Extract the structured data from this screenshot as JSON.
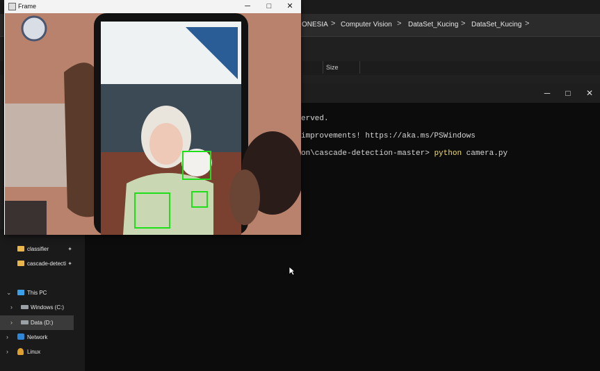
{
  "explorer": {
    "breadcrumbs": [
      "ONESIA",
      "Computer Vision",
      "DataSet_Kucing",
      "DataSet_Kucing"
    ],
    "breadcrumb_separator": ">",
    "column_headers": {
      "size": "Size"
    },
    "sidebar": {
      "items": [
        {
          "label": "classifier",
          "pinned": true
        },
        {
          "label": "cascade-detecti",
          "pinned": true
        }
      ],
      "this_pc": "This PC",
      "drives": [
        "Windows (C:)",
        "Data (D:)"
      ],
      "network": "Network",
      "linux": "Linux"
    }
  },
  "terminal": {
    "lines": [
      {
        "text": "erved."
      },
      {
        "text": "improvements! https://aka.ms/PSWindows"
      },
      {
        "prompt": "on\\cascade-detection-master> ",
        "command": "python",
        "args": " camera.py"
      }
    ],
    "buttons": {
      "minimize": "─",
      "maximize": "□",
      "close": "✕"
    }
  },
  "frame": {
    "title": "Frame",
    "buttons": {
      "minimize": "─",
      "maximize": "□",
      "close": "✕"
    }
  },
  "colors": {
    "detection_box": "#1de018",
    "command_highlight": "#f2e05a",
    "terminal_bg": "#0c0c0c"
  }
}
